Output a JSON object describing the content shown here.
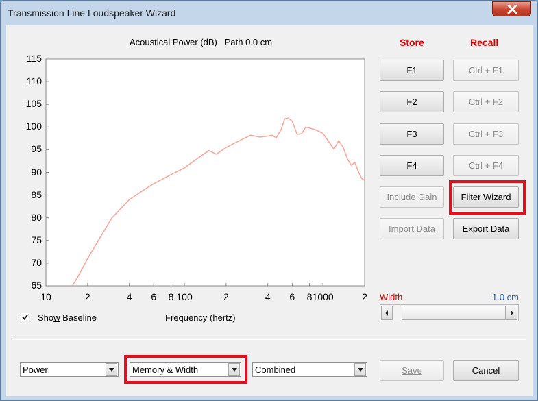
{
  "window": {
    "title": "Transmission Line Loudspeaker Wizard"
  },
  "chart_header": {
    "title": "Acoustical Power (dB)",
    "path": "Path 0.0 cm"
  },
  "memory": {
    "store_label": "Store",
    "recall_label": "Recall",
    "store_buttons": [
      "F1",
      "F2",
      "F3",
      "F4"
    ],
    "recall_buttons": [
      "Ctrl + F1",
      "Ctrl + F2",
      "Ctrl + F3",
      "Ctrl + F4"
    ]
  },
  "actions": {
    "include_gain": "Include Gain",
    "filter_wizard": "Filter Wizard",
    "import_data": "Import Data",
    "export_data": "Export Data"
  },
  "width_control": {
    "label": "Width",
    "value": "1.0 cm",
    "level": 0.0
  },
  "baseline": {
    "label_pre": "Sho",
    "label_accel": "w",
    "label_post": " Baseline",
    "checked": true
  },
  "bottom": {
    "mode_select": "Power",
    "view_select": "Memory & Width",
    "combine_select": "Combined",
    "save": "Save",
    "cancel": "Cancel"
  },
  "colors": {
    "curve": "#f4a8a0",
    "accent_red": "#e00000",
    "link_blue": "#1f5fbf",
    "highlight": "#e0101e"
  },
  "chart_data": {
    "type": "line",
    "title": "Acoustical Power (dB)   Path 0.0 cm",
    "xlabel": "Frequency (hertz)",
    "ylabel": "",
    "x_scale": "log",
    "xlim": [
      10,
      2000
    ],
    "ylim": [
      65,
      115
    ],
    "yticks": [
      "115",
      "110",
      "105",
      "100",
      "95",
      "90",
      "85",
      "80",
      "75",
      "70",
      "65"
    ],
    "xticks": [
      "10",
      "2",
      "4",
      "6",
      "8",
      "100",
      "2",
      "4",
      "6",
      "8",
      "1000",
      "2"
    ],
    "xtick_values": [
      10,
      20,
      40,
      60,
      80,
      100,
      200,
      400,
      600,
      800,
      1000,
      2000
    ],
    "grid": false,
    "series": [
      {
        "x": [
          15.5,
          17,
          20,
          25,
          30,
          40,
          50,
          60,
          80,
          100,
          130,
          150,
          170,
          200,
          250,
          300,
          350,
          400,
          430,
          460,
          500,
          530,
          560,
          600,
          650,
          700,
          750,
          800,
          900,
          1000,
          1100,
          1200,
          1300,
          1400,
          1500,
          1600,
          1700,
          1800,
          1900,
          2000
        ],
        "y": [
          65,
          67,
          71,
          76,
          80,
          84,
          86,
          87.5,
          89.5,
          91,
          93.5,
          94.8,
          94,
          95.5,
          97,
          98.2,
          97.8,
          98,
          98.2,
          97.6,
          99.5,
          101.8,
          102,
          101.3,
          98.4,
          98.5,
          100,
          99.8,
          99.3,
          98.6,
          96.8,
          95.1,
          97,
          95.5,
          93,
          91.6,
          92.2,
          90.2,
          88.7,
          88.2
        ]
      }
    ]
  }
}
